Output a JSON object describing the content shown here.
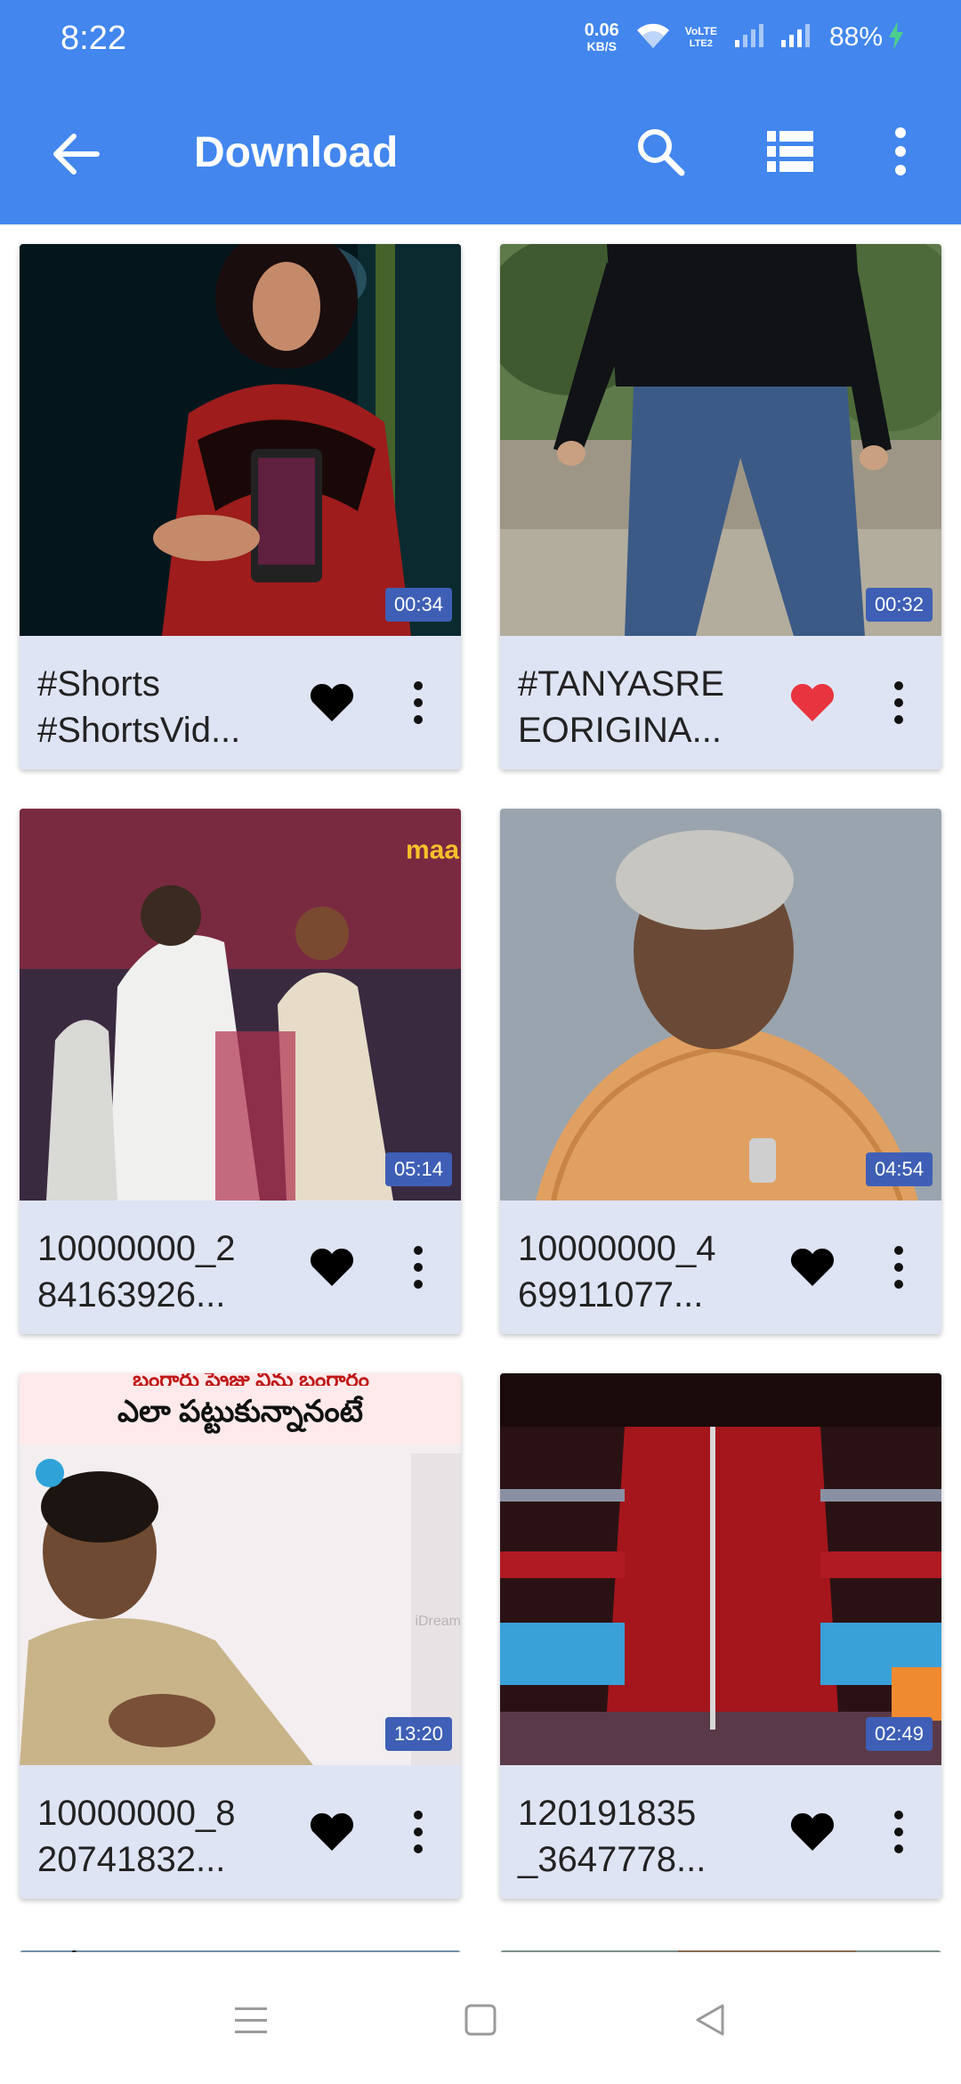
{
  "status_bar": {
    "time": "8:22",
    "net_speed": "0.06",
    "net_unit": "KB/S",
    "volte_line1": "VoLTE",
    "volte_line2": "LTE2",
    "battery": "88%"
  },
  "toolbar": {
    "title": "Download",
    "icons": [
      "back-arrow-icon",
      "search-icon",
      "list-view-icon",
      "more-vert-icon"
    ]
  },
  "videos": [
    {
      "title": "#Shorts #ShortsVid...",
      "duration": "00:34",
      "favorite": false
    },
    {
      "title": "#TANYASRE EORIGINA...",
      "duration": "00:32",
      "favorite": true
    },
    {
      "title": "10000000_2 84163926...",
      "duration": "05:14",
      "favorite": false
    },
    {
      "title": "10000000_4 69911077...",
      "duration": "04:54",
      "favorite": false
    },
    {
      "title": "10000000_8 20741832...",
      "duration": "13:20",
      "favorite": false
    },
    {
      "title": "120191835 _3647778...",
      "duration": "02:49",
      "favorite": false
    }
  ],
  "thumb_texts": {
    "logo_badge": "maa",
    "telugu_caption_top": "బంగారు ప్రైజు విను బంగారం",
    "telugu_caption": "ఎలా పట్టుకున్నానంటే",
    "watermark": "iDream"
  },
  "colors": {
    "appbar": "#4286EE",
    "card_bg": "#DFE4F4",
    "duration_badge": "#3E5FB5",
    "favorite_on": "#E8343F",
    "favorite_off": "#000000"
  },
  "nav_bar": {
    "icons": [
      "menu-icon",
      "home-square-icon",
      "back-triangle-icon"
    ]
  }
}
